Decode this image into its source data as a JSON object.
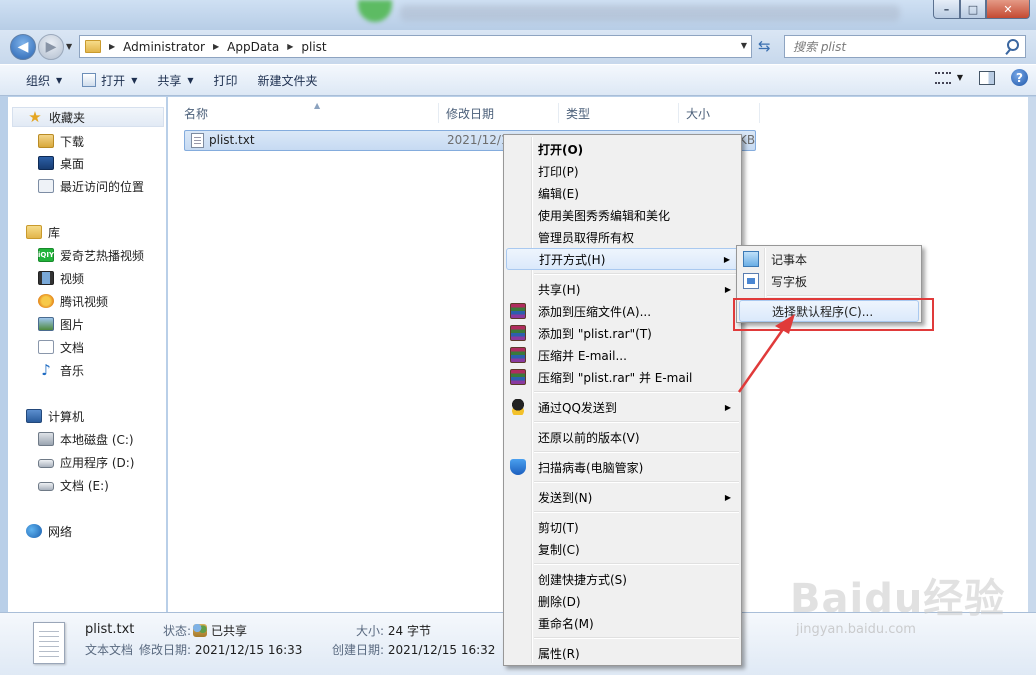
{
  "breadcrumb": [
    "Administrator",
    "AppData",
    "plist"
  ],
  "search": {
    "placeholder": "搜索 plist"
  },
  "toolbar": {
    "organize": "组织",
    "open": "打开",
    "share": "共享",
    "print": "打印",
    "new_folder": "新建文件夹"
  },
  "sidebar": {
    "favorites": {
      "label": "收藏夹",
      "items": [
        "下载",
        "桌面",
        "最近访问的位置"
      ]
    },
    "libraries": {
      "label": "库",
      "items": [
        "爱奇艺热播视频",
        "视频",
        "腾讯视频",
        "图片",
        "文档",
        "音乐"
      ]
    },
    "computer": {
      "label": "计算机",
      "items": [
        "本地磁盘 (C:)",
        "应用程序 (D:)",
        "文档 (E:)"
      ]
    },
    "network": {
      "label": "网络"
    }
  },
  "columns": {
    "name": "名称",
    "modified": "修改日期",
    "type": "类型",
    "size": "大小"
  },
  "file": {
    "name": "plist.txt",
    "date_partial": "2021/12/1",
    "size_partial": "KB"
  },
  "context_menu": {
    "open": "打开(O)",
    "print": "打印(P)",
    "edit": "编辑(E)",
    "meitu": "使用美图秀秀编辑和美化",
    "take_ownership": "管理员取得所有权",
    "open_with": "打开方式(H)",
    "share": "共享(H)",
    "add_archive": "添加到压缩文件(A)...",
    "add_rar": "添加到 \"plist.rar\"(T)",
    "compress_email": "压缩并 E-mail...",
    "compress_rar_email": "压缩到 \"plist.rar\" 并 E-mail",
    "send_qq": "通过QQ发送到",
    "restore": "还原以前的版本(V)",
    "scan": "扫描病毒(电脑管家)",
    "send_to": "发送到(N)",
    "cut": "剪切(T)",
    "copy": "复制(C)",
    "create_shortcut": "创建快捷方式(S)",
    "delete": "删除(D)",
    "rename": "重命名(M)",
    "properties": "属性(R)"
  },
  "submenu": {
    "notepad": "记事本",
    "wordpad": "写字板",
    "choose_default": "选择默认程序(C)..."
  },
  "details": {
    "filename": "plist.txt",
    "filetype": "文本文档",
    "state_label": "状态:",
    "state_value": "已共享",
    "modified_label": "修改日期:",
    "modified_value": "2021/12/15 16:33",
    "size_label": "大小:",
    "size_value": "24 字节",
    "created_label": "创建日期:",
    "created_value": "2021/12/15 16:32"
  },
  "watermark": {
    "main": "Baidu经验",
    "sub": "jingyan.baidu.com"
  },
  "colors": {
    "highlight_border": "#e03a3a",
    "accent": "#2a65b3"
  }
}
